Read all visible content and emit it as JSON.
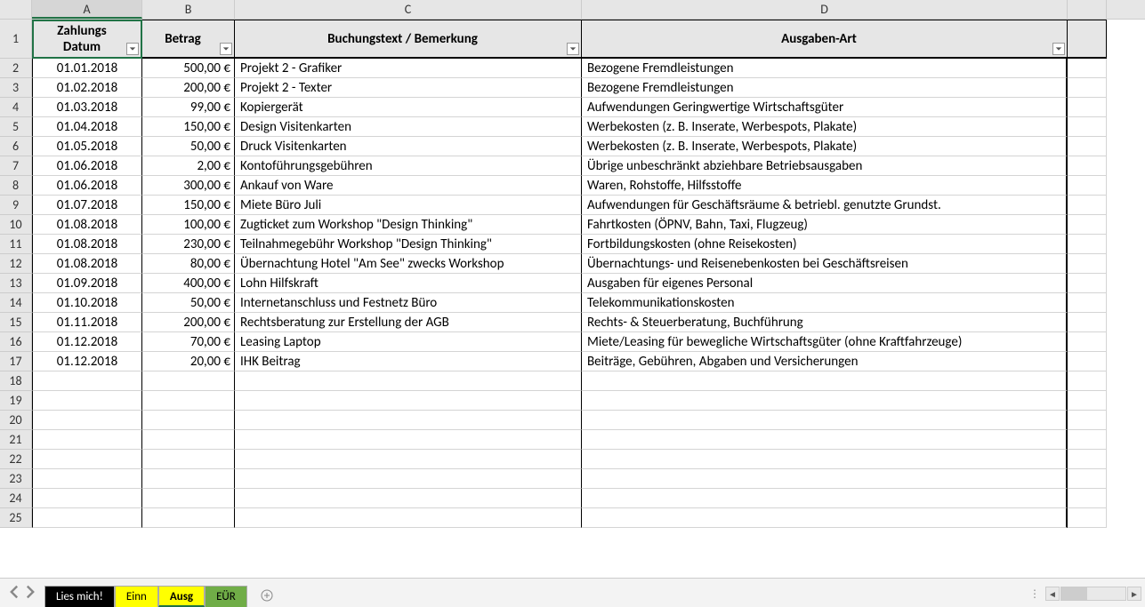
{
  "columns": [
    "A",
    "B",
    "C",
    "D"
  ],
  "headers": {
    "A": "Zahlungs Datum",
    "B": "Betrag",
    "C": "Buchungstext / Bemerkung",
    "D": "Ausgaben-Art"
  },
  "rows": [
    {
      "n": 2,
      "A": "01.01.2018",
      "B": "500,00 €",
      "C": "Projekt 2 - Grafiker",
      "D": "Bezogene Fremdleistungen"
    },
    {
      "n": 3,
      "A": "01.02.2018",
      "B": "200,00 €",
      "C": "Projekt 2 - Texter",
      "D": "Bezogene Fremdleistungen"
    },
    {
      "n": 4,
      "A": "01.03.2018",
      "B": "99,00 €",
      "C": "Kopiergerät",
      "D": "Aufwendungen Geringwertige Wirtschaftsgüter"
    },
    {
      "n": 5,
      "A": "01.04.2018",
      "B": "150,00 €",
      "C": "Design Visitenkarten",
      "D": "Werbekosten (z. B. Inserate, Werbespots, Plakate)"
    },
    {
      "n": 6,
      "A": "01.05.2018",
      "B": "50,00 €",
      "C": "Druck Visitenkarten",
      "D": "Werbekosten (z. B. Inserate, Werbespots, Plakate)"
    },
    {
      "n": 7,
      "A": "01.06.2018",
      "B": "2,00 €",
      "C": "Kontoführungsgebühren",
      "D": "Übrige unbeschränkt abziehbare Betriebsausgaben"
    },
    {
      "n": 8,
      "A": "01.06.2018",
      "B": "300,00 €",
      "C": "Ankauf von Ware",
      "D": "Waren, Rohstoffe, Hilfsstoffe"
    },
    {
      "n": 9,
      "A": "01.07.2018",
      "B": "150,00 €",
      "C": "Miete Büro Juli",
      "D": "Aufwendungen für Geschäftsräume & betriebl. genutzte Grundst."
    },
    {
      "n": 10,
      "A": "01.08.2018",
      "B": "100,00 €",
      "C": "Zugticket zum Workshop \"Design Thinking\"",
      "D": "Fahrtkosten (ÖPNV, Bahn, Taxi, Flugzeug)"
    },
    {
      "n": 11,
      "A": "01.08.2018",
      "B": "230,00 €",
      "C": "Teilnahmegebühr Workshop \"Design Thinking\"",
      "D": "Fortbildungskosten (ohne Reisekosten)"
    },
    {
      "n": 12,
      "A": "01.08.2018",
      "B": "80,00 €",
      "C": "Übernachtung Hotel \"Am See\" zwecks Workshop",
      "D": "Übernachtungs- und Reisenebenkosten bei Geschäftsreisen"
    },
    {
      "n": 13,
      "A": "01.09.2018",
      "B": "400,00 €",
      "C": "Lohn Hilfskraft",
      "D": "Ausgaben für eigenes Personal"
    },
    {
      "n": 14,
      "A": "01.10.2018",
      "B": "50,00 €",
      "C": "Internetanschluss und Festnetz Büro",
      "D": "Telekommunikationskosten"
    },
    {
      "n": 15,
      "A": "01.11.2018",
      "B": "200,00 €",
      "C": "Rechtsberatung zur Erstellung der AGB",
      "D": "Rechts- & Steuerberatung, Buchführung"
    },
    {
      "n": 16,
      "A": "01.12.2018",
      "B": "70,00 €",
      "C": "Leasing Laptop",
      "D": "Miete/Leasing für bewegliche Wirtschaftsgüter (ohne Kraftfahrzeuge)"
    },
    {
      "n": 17,
      "A": "01.12.2018",
      "B": "20,00 €",
      "C": "IHK Beitrag",
      "D": "Beiträge, Gebühren, Abgaben und Versicherungen"
    }
  ],
  "emptyRows": [
    18,
    19,
    20,
    21,
    22,
    23,
    24,
    25
  ],
  "tabs": {
    "lies": "Lies mich!",
    "einn": "Einn",
    "ausg": "Ausg",
    "eur": "EÜR"
  },
  "activeCell": "A1",
  "activeTab": "Ausg"
}
